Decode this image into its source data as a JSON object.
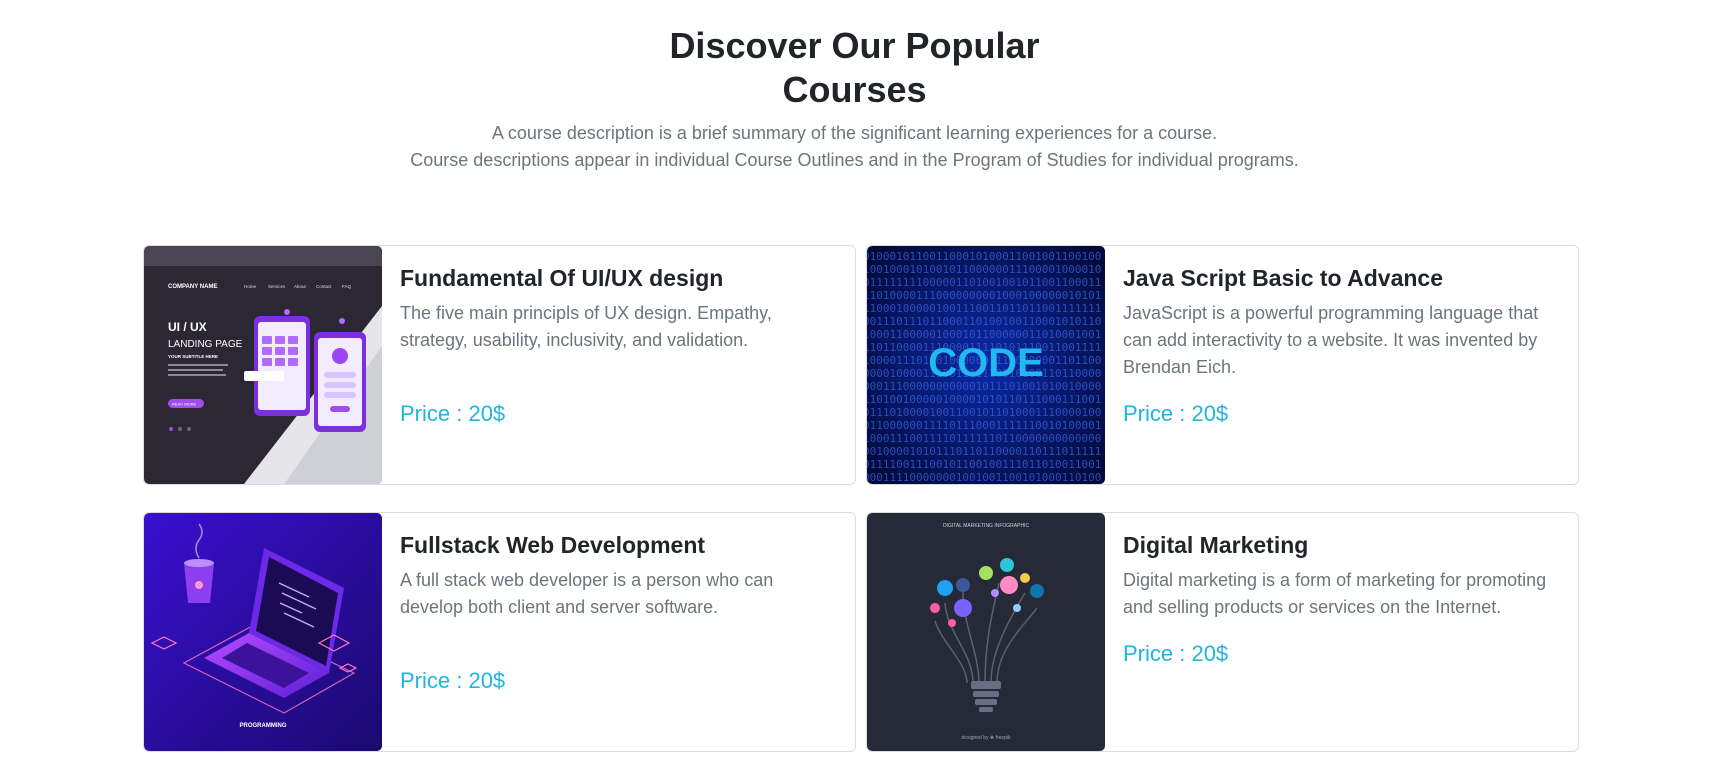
{
  "section": {
    "title_line1": "Discover Our Popular",
    "title_line2": "Courses",
    "desc_line1": "A course description is a brief summary of the significant learning experiences for a course.",
    "desc_line2": "Course descriptions appear in individual Course Outlines and in the Program of Studies for individual programs."
  },
  "courses": [
    {
      "title": "Fundamental Of UI/UX design",
      "text": "The five main principls of UX design. Empathy, strategy, usability, inclusivity, and validation.",
      "price": "Price : 20$",
      "image": {
        "company": "COMPANY NAME",
        "nav": [
          "Home",
          "Services",
          "About",
          "Contact",
          "FAQ"
        ],
        "heading": "UI / UX",
        "sub": "LANDING PAGE",
        "tag": "YOUR SUBTITLE HERE",
        "cta": "READ MORE"
      }
    },
    {
      "title": "Java Script Basic to Advance",
      "text": "JavaScript is a powerful programming language that can add interactivity to a website. It was invented by Brendan Eich.",
      "price": "Price : 20$",
      "image": {
        "word": "CODE"
      }
    },
    {
      "title": "Fullstack Web Development",
      "text": "A full stack web developer is a person who can develop both client and server software.",
      "price": "Price : 20$",
      "image": {
        "caption": "PROGRAMMING"
      }
    },
    {
      "title": "Digital Marketing",
      "text": "Digital marketing is a form of marketing for promoting and selling products or services on the Internet.",
      "price": "Price : 20$",
      "image": {
        "top": "DIGITAL MARKETING INFOGRAPHIC",
        "bottom": "designed by ❀ freepik"
      }
    }
  ],
  "colors": {
    "price": "#20b5dc",
    "muted": "#6c757d",
    "heading": "#212529",
    "border": "#dcdcdc"
  }
}
